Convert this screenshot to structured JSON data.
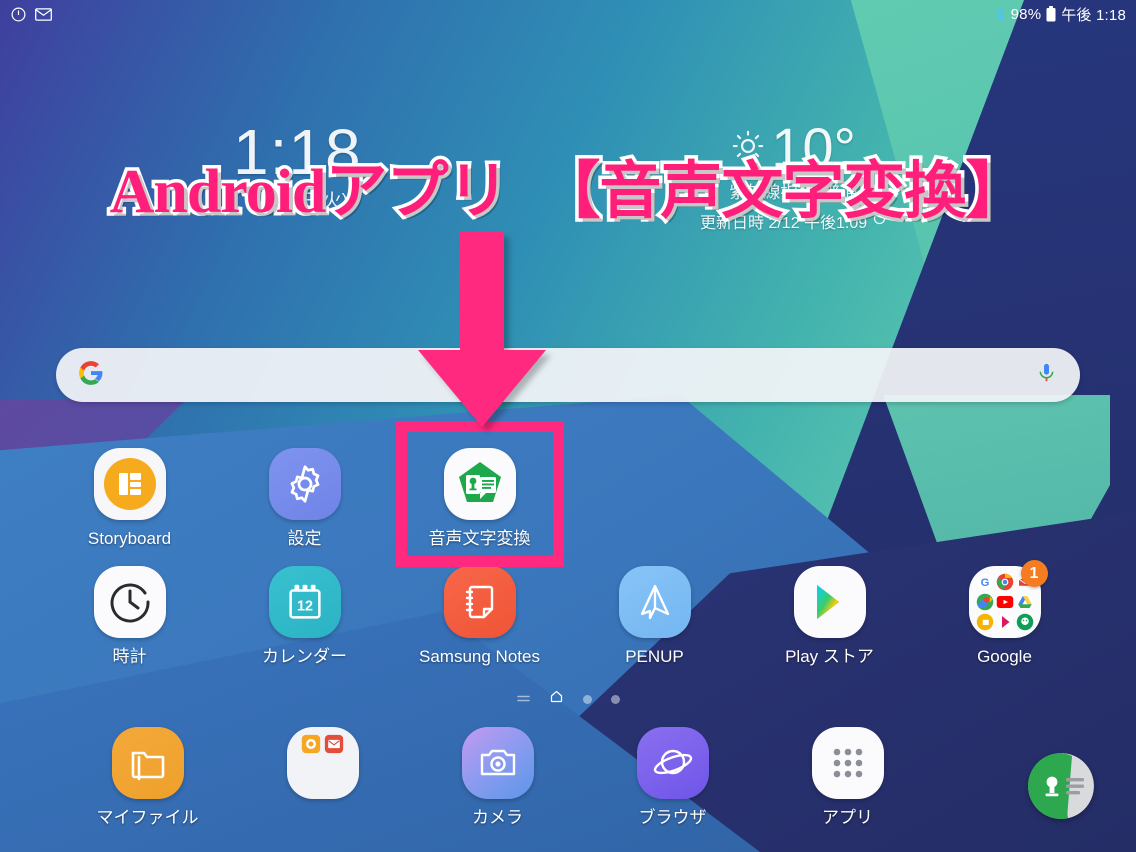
{
  "status_bar": {
    "left_icons": [
      "power-clock-icon",
      "gmail-icon"
    ],
    "bluetooth_icon": "bluetooth-icon",
    "battery_percent": "98%",
    "battery_icon": "battery-icon",
    "time": "午後 1:18"
  },
  "widgets": {
    "clock": {
      "time": "1:18",
      "date": "2月12日(火)"
    },
    "weather": {
      "temperature": "10°",
      "condition": "紫外線指数: 普通",
      "updated": "更新日時 2/12 午後1:09",
      "refresh_icon": "refresh-icon",
      "sun_icon": "sun-icon"
    }
  },
  "overlay": {
    "title_part1": "Android",
    "title_part2": "アプリ　【音声文字変換】",
    "title_color": "#ff1f7a",
    "highlight_color": "#ff2a80",
    "arrow_icon": "down-arrow-annotation"
  },
  "search": {
    "google_icon": "google-g-icon",
    "mic_icon": "microphone-icon",
    "value": "",
    "placeholder": ""
  },
  "home": {
    "row1": [
      {
        "label": "Storyboard",
        "icon": "storyboard-icon"
      },
      {
        "label": "設定",
        "icon": "settings-gear-icon"
      },
      {
        "label": "音声文字変換",
        "icon": "live-transcribe-icon",
        "highlighted": true
      }
    ],
    "row2": [
      {
        "label": "時計",
        "icon": "clock-icon"
      },
      {
        "label": "カレンダー",
        "icon": "calendar-icon",
        "day": "12"
      },
      {
        "label": "Samsung Notes",
        "icon": "samsung-notes-icon"
      },
      {
        "label": "PENUP",
        "icon": "penup-icon"
      },
      {
        "label": "Play ストア",
        "icon": "play-store-icon"
      },
      {
        "label": "Google",
        "icon": "google-folder-icon",
        "badge": "1"
      }
    ],
    "dock": [
      {
        "label": "マイファイル",
        "icon": "my-files-folder-icon"
      },
      {
        "label": "",
        "icon": "app-folder-icon"
      },
      {
        "label": "カメラ",
        "icon": "camera-icon"
      },
      {
        "label": "ブラウザ",
        "icon": "internet-browser-icon"
      },
      {
        "label": "アプリ",
        "icon": "apps-grid-icon"
      }
    ],
    "page_indicator": {
      "list_icon": "list-pages-icon",
      "home_icon": "home-page-icon",
      "dots": 2
    },
    "floating_shortcut": {
      "icon": "live-transcribe-float-icon"
    }
  }
}
